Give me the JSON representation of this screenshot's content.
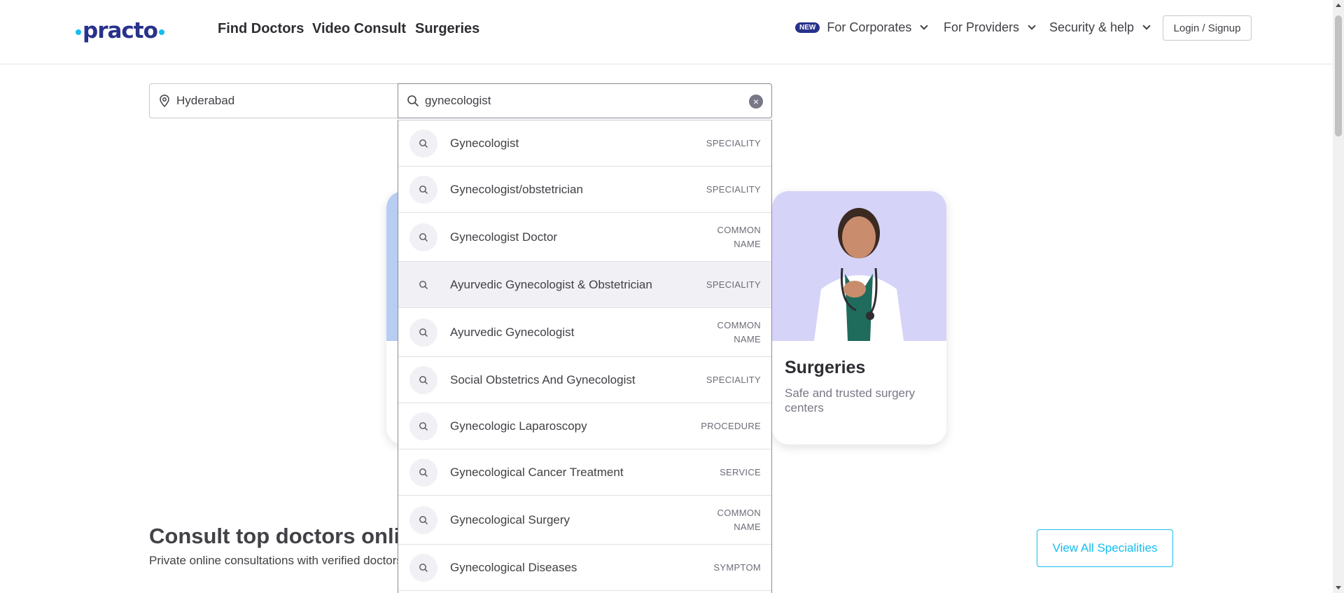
{
  "header": {
    "logo_text": "practo",
    "nav_main": [
      "Find Doctors",
      "Video Consult",
      "Surgeries"
    ],
    "new_badge": "NEW",
    "nav_right": [
      "For Corporates",
      "For Providers",
      "Security & help"
    ],
    "login_label": "Login / Signup"
  },
  "search": {
    "location_value": "Hyderabad",
    "query_value": "gynecologist"
  },
  "suggestions": [
    {
      "label": "Gynecologist",
      "type": "SPECIALITY"
    },
    {
      "label": "Gynecologist/obstetrician",
      "type": "SPECIALITY"
    },
    {
      "label": "Gynecologist Doctor",
      "type": "COMMON NAME"
    },
    {
      "label": "Ayurvedic Gynecologist & Obstetrician",
      "type": "SPECIALITY"
    },
    {
      "label": "Ayurvedic Gynecologist",
      "type": "COMMON NAME"
    },
    {
      "label": "Social Obstetrics And Gynecologist",
      "type": "SPECIALITY"
    },
    {
      "label": "Gynecologic Laparoscopy",
      "type": "PROCEDURE"
    },
    {
      "label": "Gynecological Cancer Treatment",
      "type": "SERVICE"
    },
    {
      "label": "Gynecological Surgery",
      "type": "COMMON NAME"
    },
    {
      "label": "Gynecological Diseases",
      "type": "SYMPTOM"
    }
  ],
  "cards": {
    "surgeries": {
      "title": "Surgeries",
      "subtitle": "Safe and trusted surgery centers"
    }
  },
  "section": {
    "title": "Consult top doctors online",
    "subtitle": "Private online consultations with verified doctors",
    "view_all": "View All Specialities"
  },
  "colors": {
    "brand_navy": "#28328c",
    "brand_cyan": "#14bef0"
  }
}
